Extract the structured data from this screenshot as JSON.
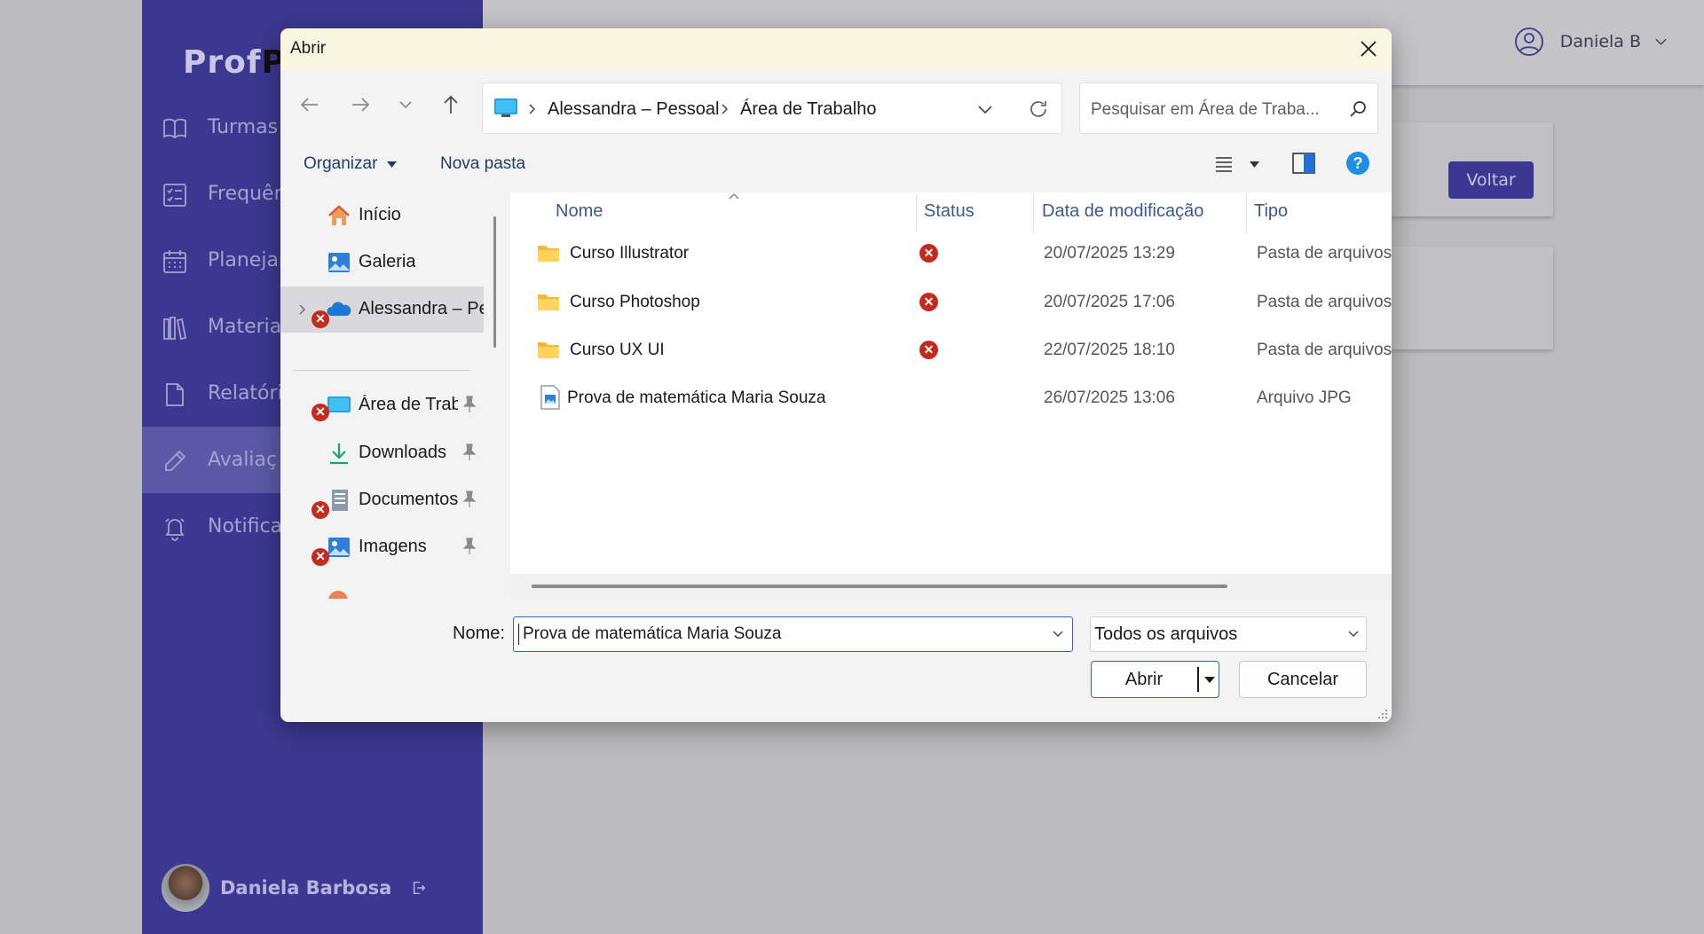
{
  "app": {
    "logo_part1": "Prof",
    "logo_part2": "Pl",
    "nav": [
      {
        "label": "Turmas",
        "icon": "book-icon"
      },
      {
        "label": "Frequên",
        "icon": "checklist-icon"
      },
      {
        "label": "Planejar",
        "icon": "calendar-icon"
      },
      {
        "label": "Materia",
        "icon": "library-icon"
      },
      {
        "label": "Relatóri",
        "icon": "document-icon"
      },
      {
        "label": "Avaliaç",
        "icon": "pencil-icon",
        "active": true
      },
      {
        "label": "Notificaç",
        "icon": "bell-icon"
      }
    ],
    "footer_user": "Daniela Barbosa",
    "top_user": "Daniela B",
    "voltar_label": "Voltar",
    "accent_color": "#3c3891"
  },
  "dialog": {
    "title": "Abrir",
    "breadcrumb": [
      "Alessandra – Pessoal",
      "Área de Trabalho"
    ],
    "search_placeholder": "Pesquisar em Área de Traba...",
    "toolbar": {
      "organize": "Organizar",
      "new_folder": "Nova pasta"
    },
    "navpane": {
      "items": [
        {
          "label": "Início",
          "icon": "home-icon"
        },
        {
          "label": "Galeria",
          "icon": "gallery-icon"
        },
        {
          "label": "Alessandra – Pes",
          "icon": "onedrive-cloud-icon",
          "selected": true,
          "error": true
        },
        {
          "label": "Área de Trab",
          "icon": "desktop-icon",
          "pinned": true,
          "error": true
        },
        {
          "label": "Downloads",
          "icon": "download-icon",
          "pinned": true
        },
        {
          "label": "Documentos",
          "icon": "documents-icon",
          "pinned": true,
          "error": true
        },
        {
          "label": "Imagens",
          "icon": "pictures-icon",
          "pinned": true,
          "error": true
        }
      ]
    },
    "columns": {
      "name": "Nome",
      "status": "Status",
      "date": "Data de modificação",
      "type": "Tipo"
    },
    "files": [
      {
        "name": "Curso Illustrator",
        "status": "error",
        "date": "20/07/2025 13:29",
        "type": "Pasta de arquivos",
        "icon": "folder-icon"
      },
      {
        "name": "Curso Photoshop",
        "status": "error",
        "date": "20/07/2025 17:06",
        "type": "Pasta de arquivos",
        "icon": "folder-icon"
      },
      {
        "name": "Curso UX UI",
        "status": "error",
        "date": "22/07/2025 18:10",
        "type": "Pasta de arquivos",
        "icon": "folder-icon"
      },
      {
        "name": "Prova de matemática Maria Souza",
        "status": "",
        "date": "26/07/2025 13:06",
        "type": "Arquivo JPG",
        "icon": "image-file-icon"
      }
    ],
    "filename_label": "Nome:",
    "filename_value": "Prova de matemática Maria Souza",
    "filter_value": "Todos os arquivos",
    "open_label": "Abrir",
    "cancel_label": "Cancelar",
    "error_mark": "✕"
  }
}
